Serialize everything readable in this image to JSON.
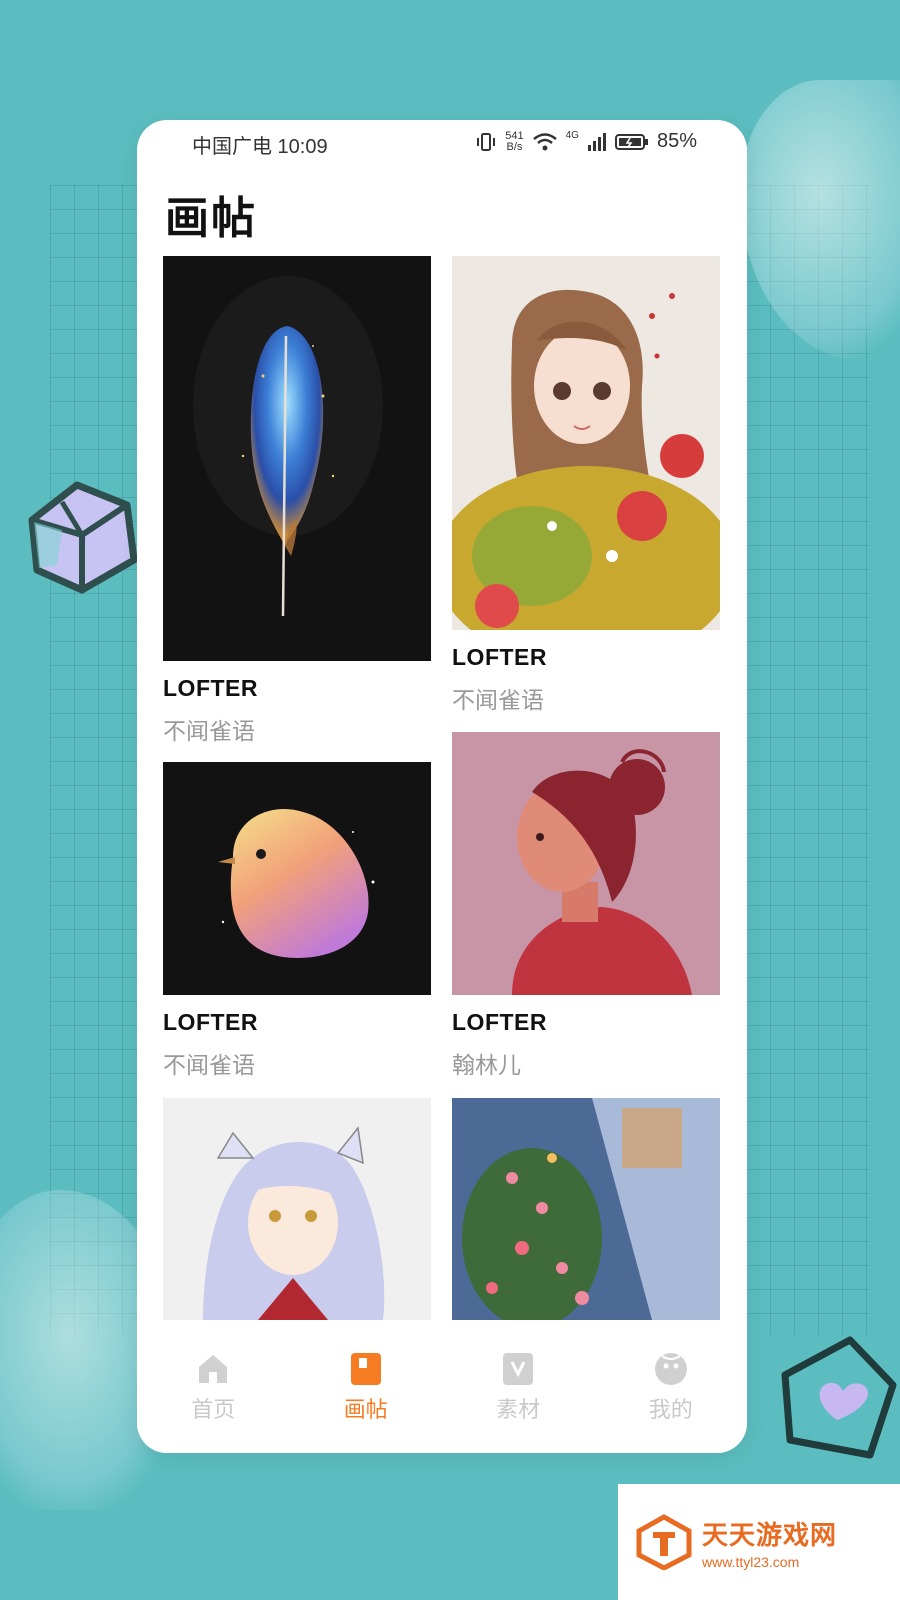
{
  "status_bar": {
    "carrier_time": "中国广电 10:09",
    "net_speed_value": "541",
    "net_speed_unit": "B/s",
    "network": "4G",
    "battery": "85%"
  },
  "page": {
    "title": "画帖"
  },
  "cards": [
    {
      "source": "LOFTER",
      "author": "不闻雀语"
    },
    {
      "source": "LOFTER",
      "author": "不闻雀语"
    },
    {
      "source": "LOFTER",
      "author": "不闻雀语"
    },
    {
      "source": "LOFTER",
      "author": "翰林儿"
    }
  ],
  "tabbar": {
    "items": [
      {
        "label": "首页",
        "icon": "home-icon",
        "active": false
      },
      {
        "label": "画帖",
        "icon": "album-icon",
        "active": true
      },
      {
        "label": "素材",
        "icon": "material-icon",
        "active": false
      },
      {
        "label": "我的",
        "icon": "profile-icon",
        "active": false
      }
    ],
    "active_color": "#f57c22",
    "inactive_color": "#c9c9c9"
  },
  "watermark": {
    "title": "天天游戏网",
    "url": "www.ttyl23.com"
  }
}
